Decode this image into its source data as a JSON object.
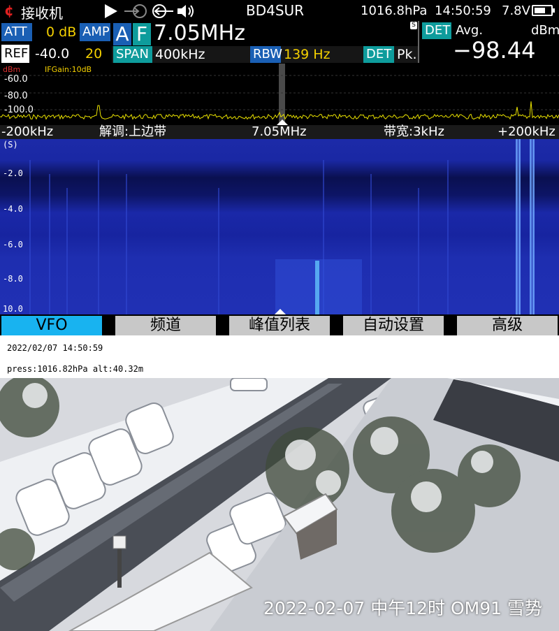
{
  "status": {
    "app_name": "接收机",
    "callsign": "BD4SUR",
    "pressure": "1016.8hPa",
    "time": "14:50:59",
    "voltage": "7.8V",
    "battery_level": 0.7
  },
  "params": {
    "att_label": "ATT",
    "att_value": "0 dB",
    "amp_label": "AMP",
    "ref_label": "REF",
    "ref_value": "-40.0",
    "amp_value": "20",
    "mode_a": "A",
    "mode_f": "F",
    "frequency": "7.05MHz",
    "span_label": "SPAN",
    "span_value": "400kHz",
    "rbw_label": "RBW",
    "rbw_value": "139 Hz",
    "det_label": "DET",
    "det_value": "Pk.",
    "s_mark": "S"
  },
  "detector": {
    "label": "DET",
    "mode": "Avg.",
    "unit": "dBm",
    "reading": "−98.44"
  },
  "spectrum": {
    "unit_label": "dBm",
    "ifgain_label": "IFGain:10dB",
    "level_labels": [
      "-60.0",
      "-80.0",
      "-100.0"
    ],
    "axis_left": "-200kHz",
    "demod": "解调:上边带",
    "center": "7.05MHz",
    "bandwidth": "带宽:3kHz",
    "axis_right": "+200kHz"
  },
  "waterfall": {
    "unit_label": "(S)",
    "time_labels": [
      "-2.0",
      "-4.0",
      "-6.0",
      "-8.0",
      "10.0"
    ]
  },
  "menu": {
    "items": [
      "VFO",
      "频道",
      "峰值列表",
      "自动设置",
      "高级"
    ],
    "active": 0
  },
  "info": {
    "datetime": "2022/02/07 14:50:59",
    "press_alt": "press:1016.82hPa alt:40.32m"
  },
  "photo": {
    "caption": "2022-02-07 中午12时 OM91 雪势"
  },
  "colors": {
    "accent_blue": "#1a5fb4",
    "accent_teal": "#0e9c9c",
    "menu_active": "#18b3f0",
    "trace": "#e8e000",
    "waterfall_base": "#1c2aa8"
  }
}
